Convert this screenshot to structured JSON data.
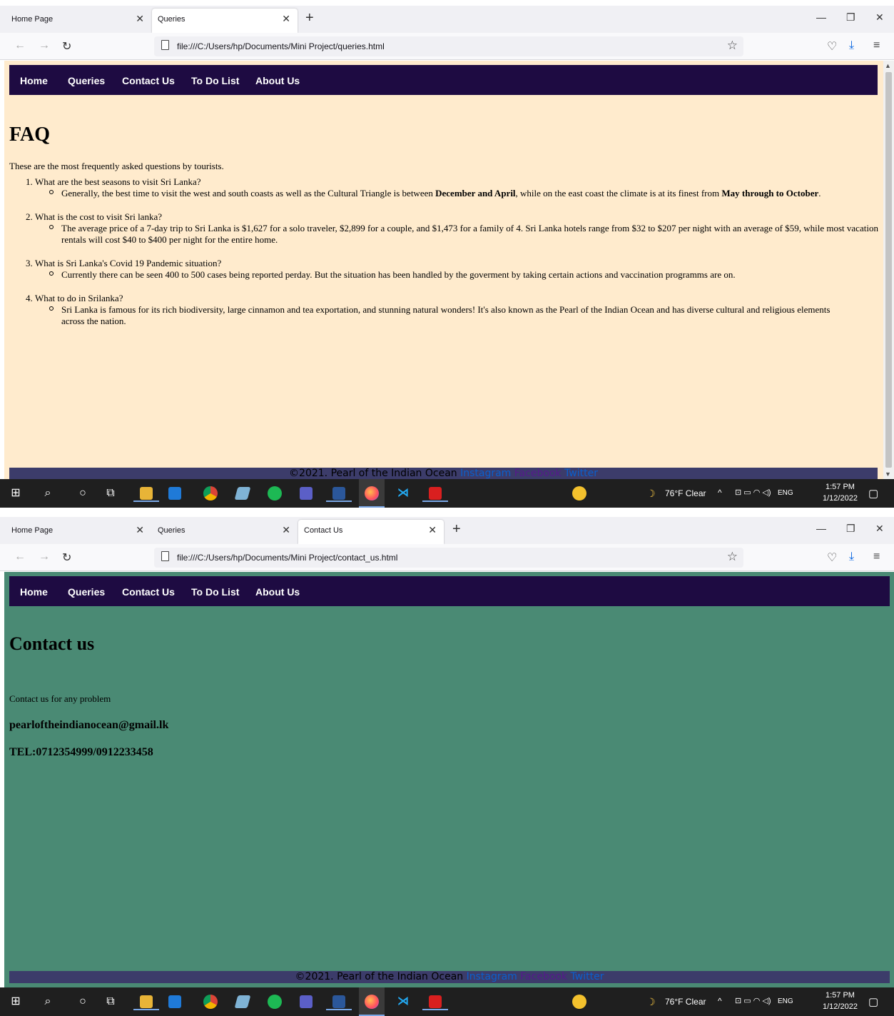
{
  "window1": {
    "tabs": [
      {
        "label": "Home Page",
        "active": false
      },
      {
        "label": "Queries",
        "active": true
      }
    ],
    "url": "file:///C:/Users/hp/Documents/Mini Project/queries.html",
    "site_nav": [
      "Home",
      "Queries",
      "Contact Us",
      "To Do List",
      "About Us"
    ],
    "page": {
      "heading": "FAQ",
      "intro": "These are the most frequently asked questions by tourists.",
      "faq": [
        {
          "num": "1.",
          "question": "What are the best seasons to visit Sri Lanka?",
          "answer_pre": "Generally, the best time to visit the west and south coasts as well as the Cultural Triangle is between ",
          "answer_bold1": "December and April",
          "answer_mid": ", while on the east coast the climate is at its finest from ",
          "answer_bold2": "May through to October",
          "answer_post": "."
        },
        {
          "num": "2.",
          "question": "What is the cost to visit Sri lanka?",
          "answer": "The average price of a 7-day trip to Sri Lanka is $1,627 for a solo traveler, $2,899 for a couple, and $1,473 for a family of 4. Sri Lanka hotels range from $32 to $207 per night with an average of $59, while most vacation rentals will cost $40 to $400 per night for the entire home."
        },
        {
          "num": "3.",
          "question": "What is Sri Lanka's Covid 19 Pandemic situation?",
          "answer": "Currently there can be seen 400 to 500 cases being reported perday. But the situation has been handled by the goverment by taking certain actions and vaccination programms are on."
        },
        {
          "num": "4.",
          "question": "What to do in Srilanka?",
          "answer": "Sri Lanka is famous for its rich biodiversity, large cinnamon and tea exportation, and stunning natural wonders! It's also known as the Pearl of the Indian Ocean and has diverse cultural and religious elements across the nation."
        }
      ]
    },
    "background_color": "#ffebcd"
  },
  "window2": {
    "tabs": [
      {
        "label": "Home Page",
        "active": false
      },
      {
        "label": "Queries",
        "active": false
      },
      {
        "label": "Contact Us",
        "active": true
      }
    ],
    "url": "file:///C:/Users/hp/Documents/Mini Project/contact_us.html",
    "site_nav": [
      "Home",
      "Queries",
      "Contact Us",
      "To Do List",
      "About Us"
    ],
    "page": {
      "heading": "Contact us",
      "line": "Contact us for any problem",
      "email": "pearloftheindianocean@gmail.lk",
      "tel": "TEL:0712354999/0912233458"
    },
    "background_color": "#4a8a74"
  },
  "footer": {
    "copyright": "©2021. Pearl of the Indian Ocean",
    "links": [
      "Instagram",
      "Facebook",
      "Twitter"
    ]
  },
  "taskbar": {
    "weather": "76°F  Clear",
    "language": "ENG",
    "time": "1:57 PM",
    "date": "1/12/2022"
  },
  "colors": {
    "site_nav_bg": "#1e0b42",
    "footer_bg": "#3c3c6a",
    "browser_accent": "#0061e0"
  }
}
